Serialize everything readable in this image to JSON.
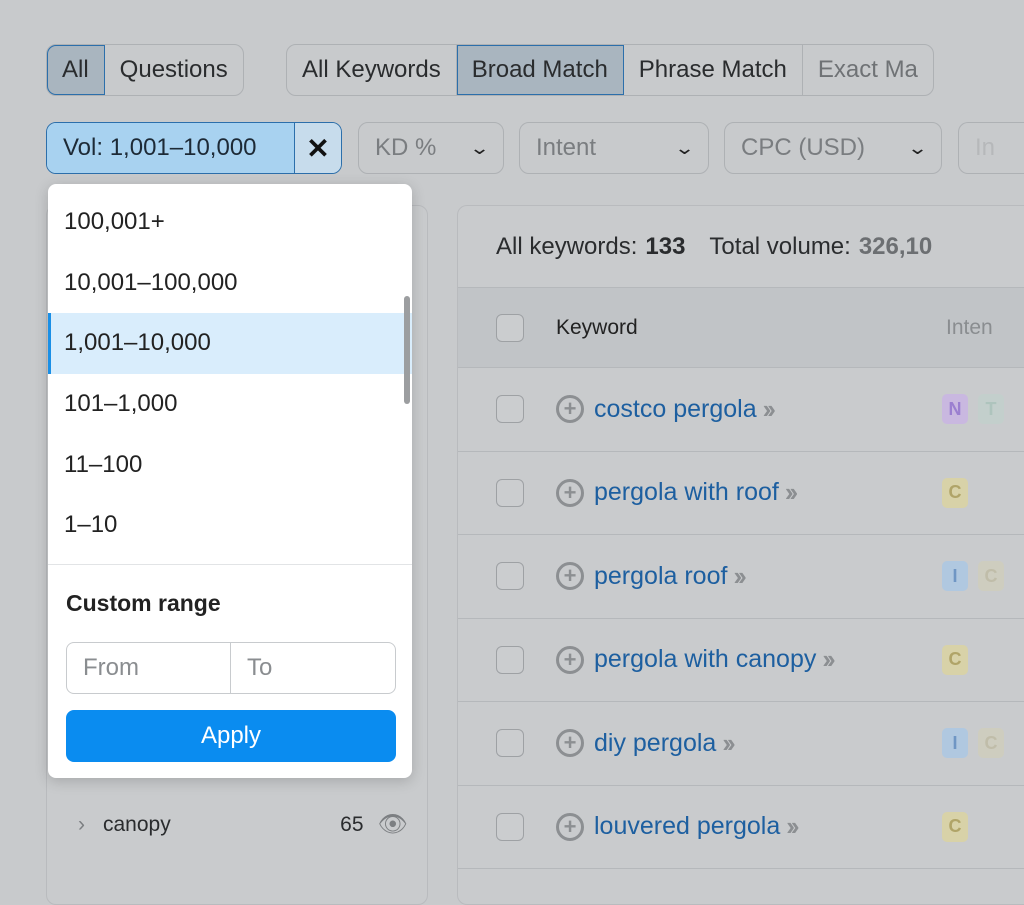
{
  "tabs_group1": [
    {
      "label": "All",
      "active": true
    },
    {
      "label": "Questions",
      "active": false
    }
  ],
  "tabs_group2": [
    {
      "label": "All Keywords",
      "active": false
    },
    {
      "label": "Broad Match",
      "active": true
    },
    {
      "label": "Phrase Match",
      "active": false
    },
    {
      "label": "Exact Ma",
      "active": false
    }
  ],
  "filters": {
    "volume": "Vol: 1,001–10,000",
    "kd": "KD %",
    "intent": "Intent",
    "cpc": "CPC (USD)",
    "more": "In"
  },
  "dropdown": {
    "options": [
      "100,001+",
      "10,001–100,000",
      "1,001–10,000",
      "101–1,000",
      "11–100",
      "1–10"
    ],
    "selected_index": 2,
    "custom_range_label": "Custom range",
    "from_placeholder": "From",
    "to_placeholder": "To",
    "apply_label": "Apply"
  },
  "left_panel": {
    "item": {
      "label": "canopy",
      "count": "65"
    }
  },
  "summary": {
    "all_keywords_label": "All keywords:",
    "all_keywords_value": "133",
    "total_volume_label": "Total volume:",
    "total_volume_value": "326,10"
  },
  "table": {
    "headers": {
      "keyword": "Keyword",
      "intent": "Inten"
    },
    "rows": [
      {
        "keyword": "costco pergola",
        "intent": "N",
        "intent2": "T"
      },
      {
        "keyword": "pergola with roof",
        "intent": "C",
        "intent2": ""
      },
      {
        "keyword": "pergola roof",
        "intent": "I",
        "intent2": "C"
      },
      {
        "keyword": "pergola with canopy",
        "intent": "C",
        "intent2": ""
      },
      {
        "keyword": "diy pergola",
        "intent": "I",
        "intent2": "C"
      },
      {
        "keyword": "louvered pergola",
        "intent": "C",
        "intent2": ""
      }
    ]
  },
  "colors": {
    "accent": "#0a8cf0",
    "link": "#1d5fa0",
    "selected_bg": "#d9edfc"
  }
}
